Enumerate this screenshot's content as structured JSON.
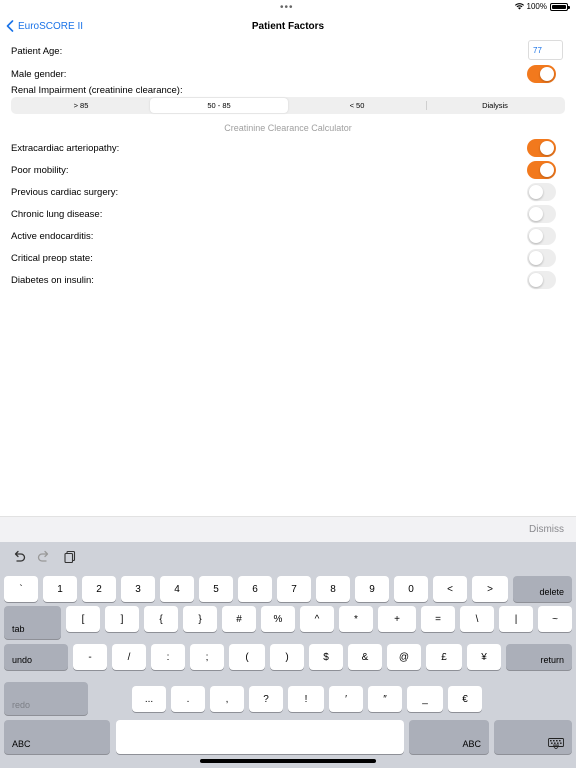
{
  "status_bar": {
    "battery_percent": "100%"
  },
  "nav": {
    "back_label": "EuroSCORE II",
    "title": "Patient Factors"
  },
  "form": {
    "age_label": "Patient Age:",
    "age_value": "77",
    "male_gender_label": "Male gender:",
    "male_gender_on": true,
    "renal_label": "Renal Impairment (creatinine clearance):",
    "renal_options": [
      "> 85",
      "50 - 85",
      "< 50",
      "Dialysis"
    ],
    "renal_selected": "50 - 85",
    "calculator_link": "Creatinine Clearance Calculator",
    "factors": [
      {
        "label": "Extracardiac arteriopathy:",
        "on": true
      },
      {
        "label": "Poor mobility:",
        "on": true
      },
      {
        "label": "Previous cardiac surgery:",
        "on": false
      },
      {
        "label": "Chronic lung disease:",
        "on": false
      },
      {
        "label": "Active endocarditis:",
        "on": false
      },
      {
        "label": "Critical preop state:",
        "on": false
      },
      {
        "label": "Diabetes on insulin:",
        "on": false
      }
    ]
  },
  "keyboard": {
    "dismiss_label": "Dismiss",
    "row1": [
      "`",
      "1",
      "2",
      "3",
      "4",
      "5",
      "6",
      "7",
      "8",
      "9",
      "0",
      "<",
      ">"
    ],
    "delete_label": "delete",
    "tab_label": "tab",
    "row2": [
      "[",
      "]",
      "{",
      "}",
      "#",
      "%",
      "^",
      "*",
      "+",
      "=",
      "\\",
      "|",
      "~"
    ],
    "undo_label": "undo",
    "row3": [
      "-",
      "/",
      ":",
      ";",
      "(",
      ")",
      "$",
      "&",
      "@",
      "£",
      "¥"
    ],
    "return_label": "return",
    "redo_label": "redo",
    "row4": [
      "...",
      ".",
      ",",
      "?",
      "!",
      "′",
      "″",
      "_",
      "€"
    ],
    "abc_left_label": "ABC",
    "abc_right_label": "ABC"
  },
  "colors": {
    "accent": "#f2791d",
    "link": "#1a73e8"
  }
}
